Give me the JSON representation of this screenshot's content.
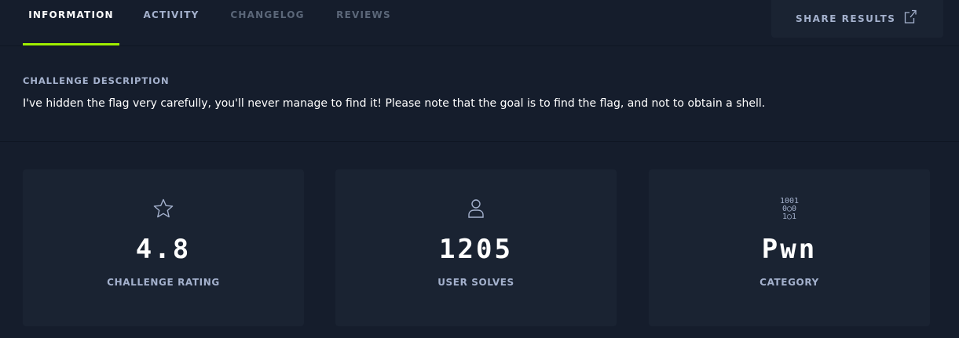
{
  "tabs": [
    {
      "label": "INFORMATION",
      "active": true
    },
    {
      "label": "ACTIVITY",
      "active": false
    },
    {
      "label": "CHANGELOG",
      "active": false
    },
    {
      "label": "REVIEWS",
      "active": false
    }
  ],
  "share": {
    "label": "SHARE RESULTS",
    "icon": "external-link-icon"
  },
  "description": {
    "heading": "CHALLENGE DESCRIPTION",
    "text": "I've hidden the flag very carefully, you'll never manage to find it! Please note that the goal is to find the flag, and not to obtain a shell."
  },
  "stats": {
    "rating": {
      "value": "4.8",
      "label": "CHALLENGE RATING",
      "icon": "star-icon"
    },
    "solves": {
      "value": "1205",
      "label": "USER SOLVES",
      "icon": "user-icon"
    },
    "category": {
      "value": "Pwn",
      "label": "CATEGORY",
      "icon": "binary-icon",
      "icon_text": [
        "1001",
        "0◯0",
        "1◯1"
      ]
    }
  },
  "colors": {
    "background": "#151d2c",
    "card": "#1a2332",
    "accent": "#9fef00",
    "muted_text": "#a4b1cd",
    "dim_text": "#5b6779"
  }
}
